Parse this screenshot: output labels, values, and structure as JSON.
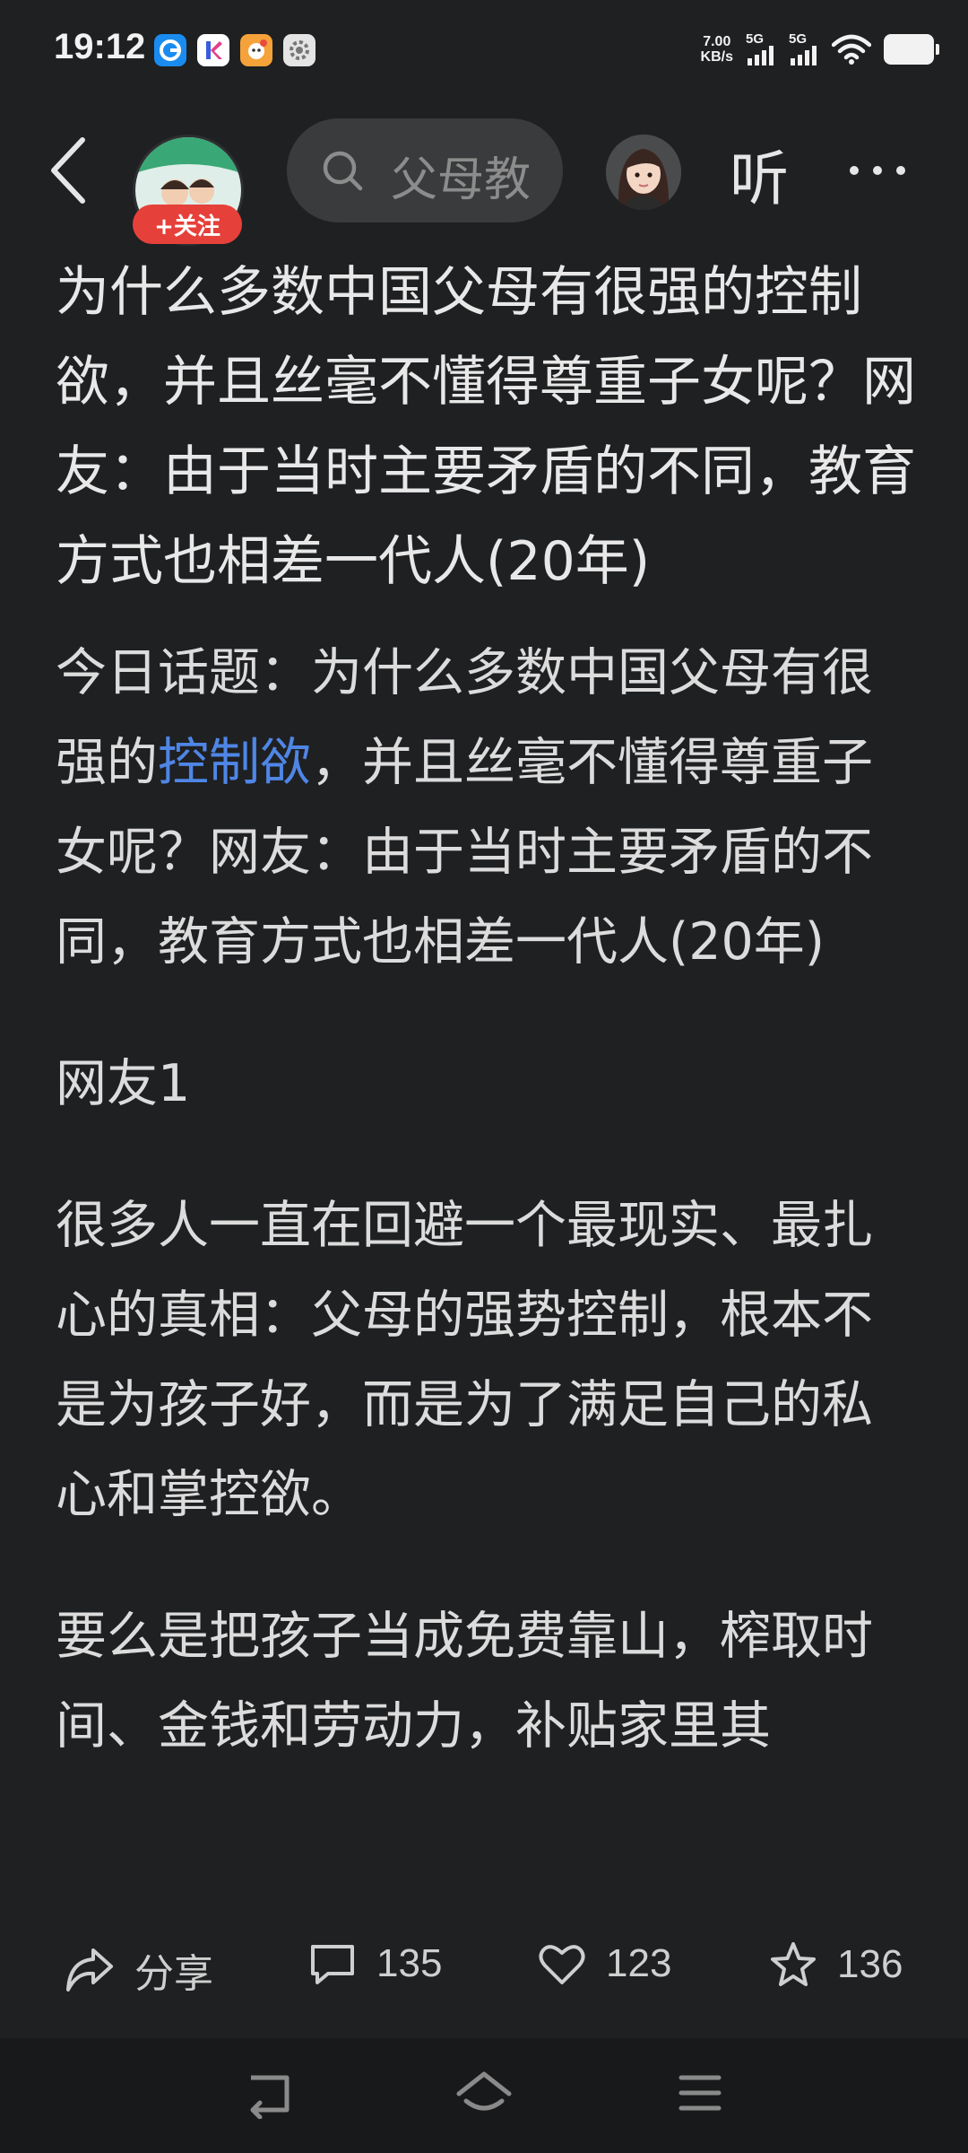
{
  "status_bar": {
    "time": "19:12",
    "net_speed_value": "7.00",
    "net_speed_unit": "KB/s",
    "signal1_label": "5G",
    "signal2_label": "5G",
    "app_icons": [
      "browser-icon",
      "app-k-icon",
      "cartoon-app-icon",
      "settings-app-icon"
    ]
  },
  "nav": {
    "follow_label": "+关注",
    "search_placeholder": "父母教",
    "listen_label": "听"
  },
  "article": {
    "title": "为什么多数中国父母有很强的控制欲，并且丝毫不懂得尊重子女呢？网友：由于当时主要矛盾的不同，教育方式也相差一代人(20年)",
    "intro_before": "今日话题：为什么多数中国父母有很强的",
    "intro_link": "控制欲",
    "intro_after": "，并且丝毫不懂得尊重子女呢？网友：由于当时主要矛盾的不同，教育方式也相差一代人(20年)",
    "section_heading": "网友1",
    "paragraph1": "很多人一直在回避一个最现实、最扎心的真相：父母的强势控制，根本不是为孩子好，而是为了满足自己的私心和掌控欲。",
    "paragraph2": "要么是把孩子当成免费靠山，榨取时间、金钱和劳动力，补贴家里其"
  },
  "actions": {
    "share_label": "分享",
    "comment_count": "135",
    "like_count": "123",
    "favorite_count": "136"
  },
  "colors": {
    "background": "#1f2022",
    "text": "#e6e6e6",
    "link": "#4f86e6",
    "follow": "#e6403a"
  }
}
